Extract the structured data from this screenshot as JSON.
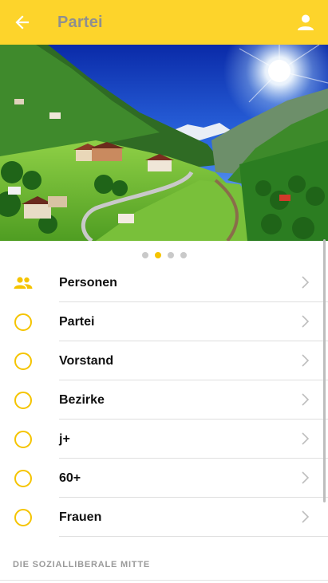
{
  "app_bar": {
    "title": "Partei",
    "back_icon": "arrow-left-icon",
    "account_icon": "person-icon",
    "color": "#fdd42b"
  },
  "hero": {
    "image": "alpine-valley-photo",
    "dots": [
      {
        "active": false
      },
      {
        "active": true
      },
      {
        "active": false
      },
      {
        "active": false
      }
    ],
    "active_dot_color": "#f5c400"
  },
  "menu": {
    "items": [
      {
        "label": "Personen",
        "icon": "people-icon"
      },
      {
        "label": "Partei",
        "icon": "circle-outline-icon"
      },
      {
        "label": "Vorstand",
        "icon": "circle-outline-icon"
      },
      {
        "label": "Bezirke",
        "icon": "circle-outline-icon"
      },
      {
        "label": "j+",
        "icon": "circle-outline-icon"
      },
      {
        "label": "60+",
        "icon": "circle-outline-icon"
      },
      {
        "label": "Frauen",
        "icon": "circle-outline-icon"
      }
    ]
  },
  "section": {
    "heading": "DIE SOZIALLIBERALE MITTE"
  }
}
